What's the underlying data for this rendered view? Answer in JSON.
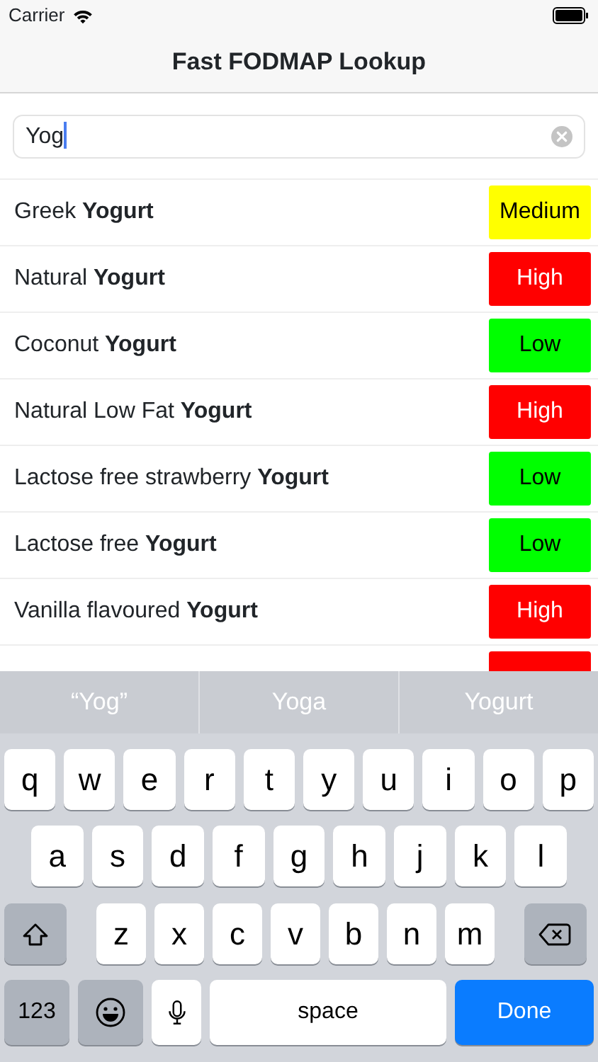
{
  "status_bar": {
    "carrier": "Carrier"
  },
  "nav_bar": {
    "title": "Fast FODMAP Lookup"
  },
  "search": {
    "value": "Yog"
  },
  "results": [
    {
      "name": "Greek **Yogurt**",
      "rating": "Medium",
      "color": "#ffff00"
    },
    {
      "name": "Natural **Yogurt**",
      "rating": "High",
      "color": "#ff0000"
    },
    {
      "name": "Coconut **Yogurt**",
      "rating": "Low",
      "color": "#00ff00"
    },
    {
      "name": "Natural Low Fat **Yogurt**",
      "rating": "High",
      "color": "#ff0000"
    },
    {
      "name": "Lactose free strawberry **Yogurt**",
      "rating": "Low",
      "color": "#00ff00"
    },
    {
      "name": "Lactose free **Yogurt**",
      "rating": "Low",
      "color": "#00ff00"
    },
    {
      "name": "Vanilla flavoured **Yogurt**",
      "rating": "High",
      "color": "#ff0000"
    },
    {
      "color": "#ff0000"
    }
  ],
  "keyboard": {
    "suggestions": [
      "“Yog”",
      "Yoga",
      "Yogurt"
    ],
    "top_row": [
      {
        "kind": "letter",
        "label": "q"
      },
      {
        "kind": "letter",
        "label": "w"
      },
      {
        "kind": "letter",
        "label": "e"
      },
      {
        "kind": "letter",
        "label": "r"
      },
      {
        "kind": "letter",
        "label": "t"
      },
      {
        "kind": "letter",
        "label": "y"
      },
      {
        "kind": "letter",
        "label": "u"
      },
      {
        "kind": "letter",
        "label": "i"
      },
      {
        "kind": "letter",
        "label": "o"
      },
      {
        "kind": "letter",
        "label": "p"
      }
    ],
    "middle_row": [
      {
        "kind": "letter",
        "label": "a"
      },
      {
        "kind": "letter",
        "label": "s"
      },
      {
        "kind": "letter",
        "label": "d"
      },
      {
        "kind": "letter",
        "label": "f"
      },
      {
        "kind": "letter",
        "label": "g"
      },
      {
        "kind": "letter",
        "label": "h"
      },
      {
        "kind": "letter",
        "label": "j"
      },
      {
        "kind": "letter",
        "label": "k"
      },
      {
        "kind": "letter",
        "label": "l"
      }
    ],
    "lower_row": [
      {
        "kind": "shift"
      },
      {
        "kind": "letter",
        "label": "z"
      },
      {
        "kind": "letter",
        "label": "x"
      },
      {
        "kind": "letter",
        "label": "c"
      },
      {
        "kind": "letter",
        "label": "v"
      },
      {
        "kind": "letter",
        "label": "b"
      },
      {
        "kind": "letter",
        "label": "n"
      },
      {
        "kind": "letter",
        "label": "m"
      },
      {
        "kind": "delete"
      }
    ],
    "bottom_row": [
      {
        "kind": "mode",
        "label": "123"
      },
      {
        "kind": "emoji"
      },
      {
        "kind": "mic"
      },
      {
        "kind": "space",
        "label": "space"
      },
      {
        "kind": "done",
        "label": "Done"
      }
    ]
  }
}
